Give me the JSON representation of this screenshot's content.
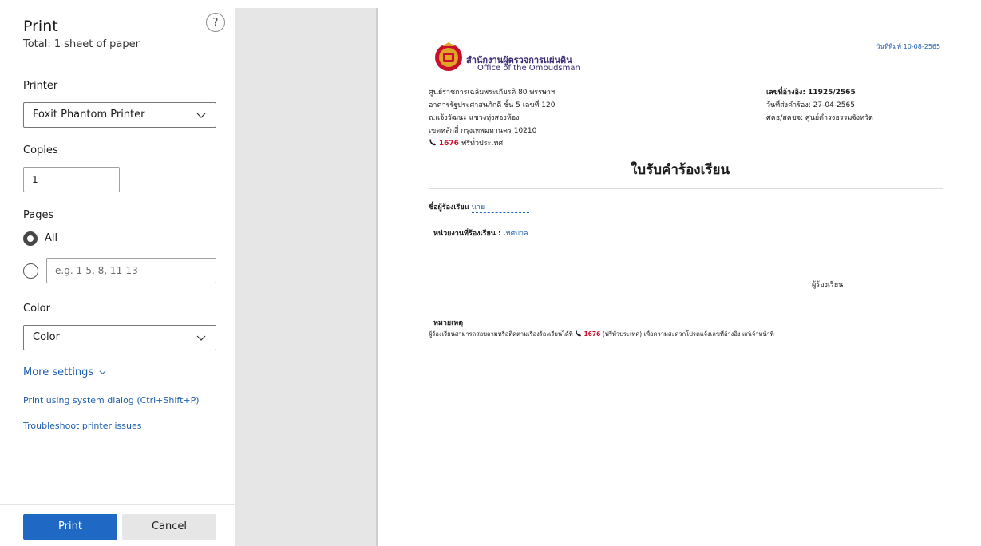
{
  "dialog": {
    "title": "Print",
    "subtitle": "Total: 1 sheet of paper",
    "help": "?",
    "printer_label": "Printer",
    "printer_value": "Foxit Phantom Printer",
    "copies_label": "Copies",
    "copies_value": "1",
    "pages_label": "Pages",
    "pages_all": "All",
    "pages_placeholder": "e.g. 1-5, 8, 11-13",
    "color_label": "Color",
    "color_value": "Color",
    "more_settings": "More settings",
    "system_dialog": "Print using system dialog (Ctrl+Shift+P)",
    "troubleshoot": "Troubleshoot printer issues",
    "print_button": "Print",
    "cancel_button": "Cancel"
  },
  "document": {
    "print_date": "วันที่พิมพ์ 10-08-2565",
    "org_th": "สำนักงานผู้ตรวจการแผ่นดิน",
    "org_en": "Office of the Ombudsman",
    "address": [
      "ศูนย์ราชการเฉลิมพระเกียรติ 80 พรรษาฯ",
      "อาคารรัฐประศาสนภักดี ชั้น 5 เลขที่ 120",
      "ถ.แจ้งวัฒนะ แขวงทุ่งสองห้อง",
      "เขตหลักสี่ กรุงเทพมหานคร 10210"
    ],
    "hotline_number": "1676",
    "hotline_text": "ฟรีทั่วประเทศ",
    "ref_no": "เลขที่อ้างอิง: 11925/2565",
    "submit_date": "วันที่ส่งคำร้อง: 27-04-2565",
    "center": "ศคธ/สคชจ: ศูนย์ดำรงธรรมจังหวัด",
    "heading": "ใบรับคำร้องเรียน",
    "complainant_label": "ชื่อผู้ร้องเรียน",
    "complainant_value": "นาย",
    "agency_label": "หน่วยงานที่ร้องเรียน :",
    "agency_value": "เทศบาล",
    "signature_dots": "......................................................",
    "signature_label": "ผู้ร้องเรียน",
    "note_title": "หมายเหตุ",
    "note_text_1": "ผู้ร้องเรียนสามารถสอบถามหรือติดตามเรื่องร้องเรียนได้ที่",
    "note_number": "1676",
    "note_text_2": "(ฟรีทั่วประเทศ) เพื่อความสะดวกโปรดแจ้งเลขที่อ้างอิง แก่เจ้าหน้าที่"
  },
  "colors": {
    "primary_button": "#1f68c4",
    "link": "#1f5fad",
    "hotline": "#c8102e",
    "preview_bg": "#e6e6e6"
  }
}
